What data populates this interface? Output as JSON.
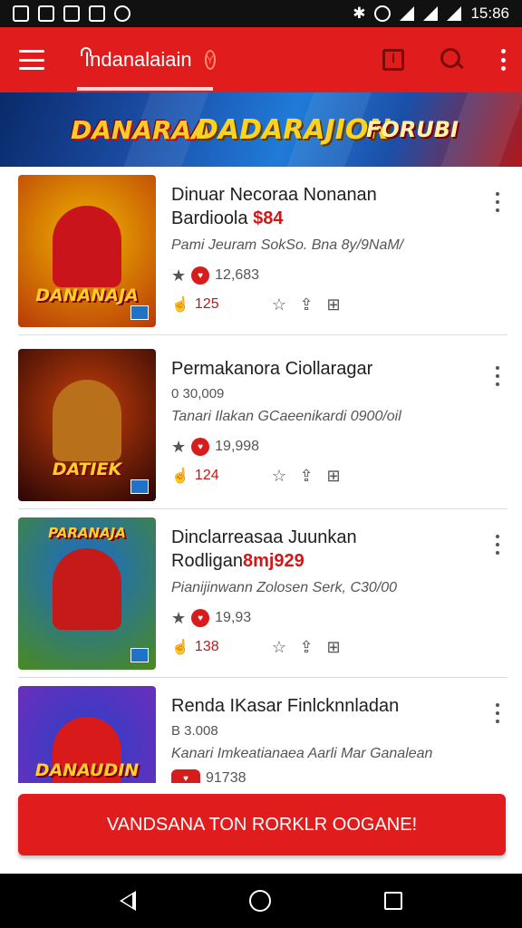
{
  "status_bar": {
    "time": "15:86"
  },
  "toolbar": {
    "app_title": "Indanalaiain"
  },
  "banner": {
    "left_logo": "DANARAA",
    "center_text": "DADARAJION",
    "right_logo": "FORUBI"
  },
  "items": [
    {
      "title_line1": "Dinuar Necoraa Nonanan",
      "title_line2": "Bardioola",
      "price": "$84",
      "subtitle": "",
      "description": "Pami Jeuram SokSo. Bna 8y/9NaM/",
      "rating": "12,683",
      "likes": "125",
      "cover_title": "DANANAJA",
      "colors": {
        "bg1": "#f0b400",
        "bg2": "#b83a08",
        "hero": "#c8141a"
      }
    },
    {
      "title_line1": "Permakanora Ciollaragar",
      "title_line2": "",
      "price": "",
      "subtitle": "0 30,009",
      "description": "Tanari Ilakan GCaeenikardi 0900/oil",
      "rating": "19,998",
      "likes": "124",
      "cover_title": "DATIEK",
      "colors": {
        "bg1": "#7a0a0a",
        "bg2": "#2a0505",
        "hero": "#b8701a"
      }
    },
    {
      "title_line1": "Dinclarreasaa Juunkan",
      "title_line2": "Rodligan",
      "price": "8mj929",
      "subtitle": "",
      "description": "Pianijinwann Zolosen Serk, C30/00",
      "rating": "19,93",
      "likes": "138",
      "cover_title": "PARANAJA",
      "colors": {
        "bg1": "#1a6ad0",
        "bg2": "#4a8a20",
        "hero": "#c41a1a"
      }
    },
    {
      "title_line1": "Renda IKasar Finlcknnladan",
      "title_line2": "",
      "price": "",
      "subtitle": "B 3.008",
      "description": "Kanari Imkeatianaea Aarli Mar Ganalean",
      "rating": "91738",
      "likes": "",
      "cover_title": "DANAUDIN",
      "colors": {
        "bg1": "#2a40c8",
        "bg2": "#7a2ab8",
        "hero": "#d81a1a"
      }
    }
  ],
  "cta": {
    "label": "VANDSANA TON RORKLR OOGANE!"
  }
}
